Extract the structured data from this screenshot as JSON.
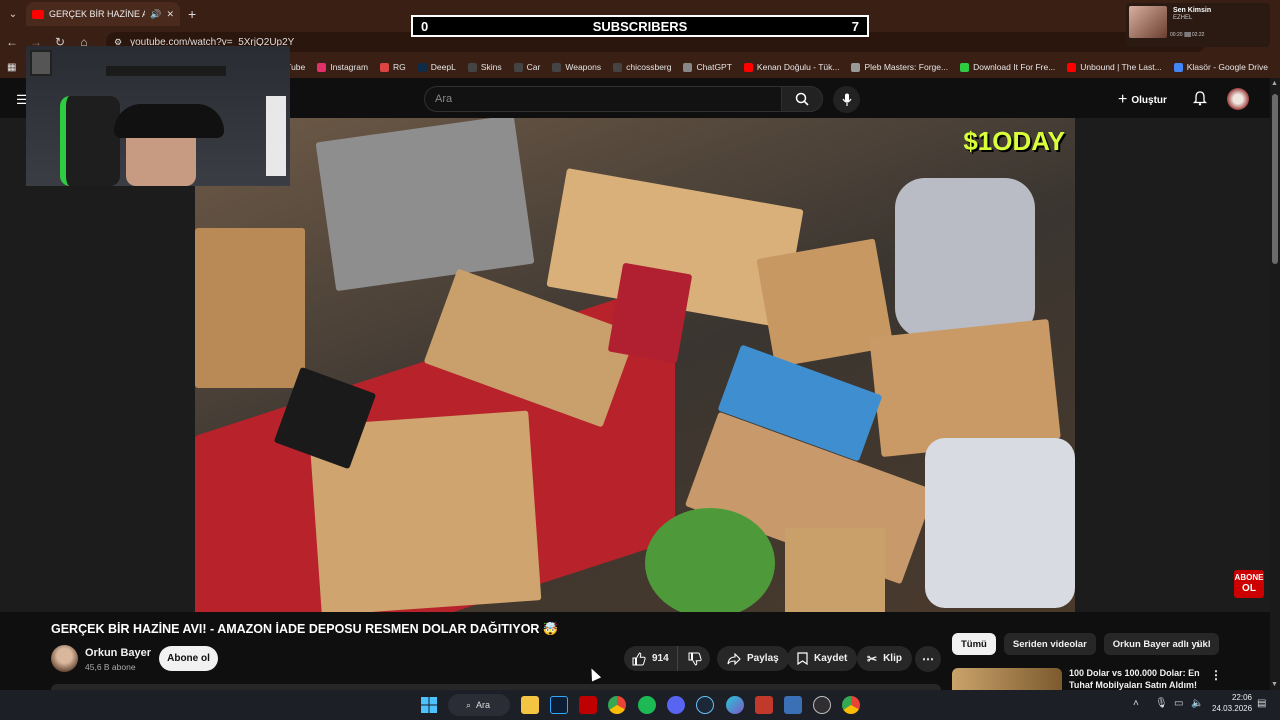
{
  "browser": {
    "tab_title": "GERÇEK BİR HAZİNE AVI! - ",
    "url": "youtube.com/watch?v=_5XrjQ2Up2Y",
    "bookmarks": [
      {
        "label": "YouTube",
        "color": "#ff0000"
      },
      {
        "label": "Instagram",
        "color": "#e1306c"
      },
      {
        "label": "RG",
        "color": "#d44"
      },
      {
        "label": "DeepL",
        "color": "#0f2b46"
      },
      {
        "label": "Skins",
        "color": "#444"
      },
      {
        "label": "Car",
        "color": "#444"
      },
      {
        "label": "Weapons",
        "color": "#444"
      },
      {
        "label": "chicossberg",
        "color": "#444"
      },
      {
        "label": "ChatGPT",
        "color": "#888"
      },
      {
        "label": "Kenan Doğulu - Tük...",
        "color": "#ff0000"
      },
      {
        "label": "Pleb Masters: Forge...",
        "color": "#999"
      },
      {
        "label": "Download It For Fre...",
        "color": "#2ecc40"
      },
      {
        "label": "Unbound | The Last...",
        "color": "#ff0000"
      },
      {
        "label": "Klasör - Google Drive",
        "color": "#4285f4"
      }
    ]
  },
  "overlay": {
    "subscribers_label": "SUBSCRIBERS",
    "subscribers_left": "0",
    "subscribers_right": "7",
    "media_title": "Sen Kimsin",
    "media_artist": "EZHEL",
    "media_time_start": "00:20",
    "media_time_end": "02:22"
  },
  "youtube": {
    "search_placeholder": "Ara",
    "create_label": "Oluştur",
    "brand_badge": "$1ODAY",
    "abone_badge_line1": "ABONE",
    "abone_badge_line2": "OL",
    "video_title": "GERÇEK BİR HAZİNE AVI! - AMAZON İADE DEPOSU RESMEN DOLAR DAĞITIYOR 🤯",
    "channel_name": "Orkun Bayer",
    "channel_subs": "45,6 B abone",
    "subscribe_label": "Abone ol",
    "likes": "914",
    "share_label": "Paylaş",
    "save_label": "Kaydet",
    "clip_label": "Klip",
    "chips": [
      "Tümü",
      "Seriden videolar",
      "Orkun Bayer adlı yükl"
    ],
    "rec_title": "100 Dolar vs 100.000 Dolar: En Tuhaf Mobilyaları Satın Aldım!"
  },
  "taskbar": {
    "search_label": "Ara",
    "time": "22:06",
    "date": "24.03.2026"
  }
}
